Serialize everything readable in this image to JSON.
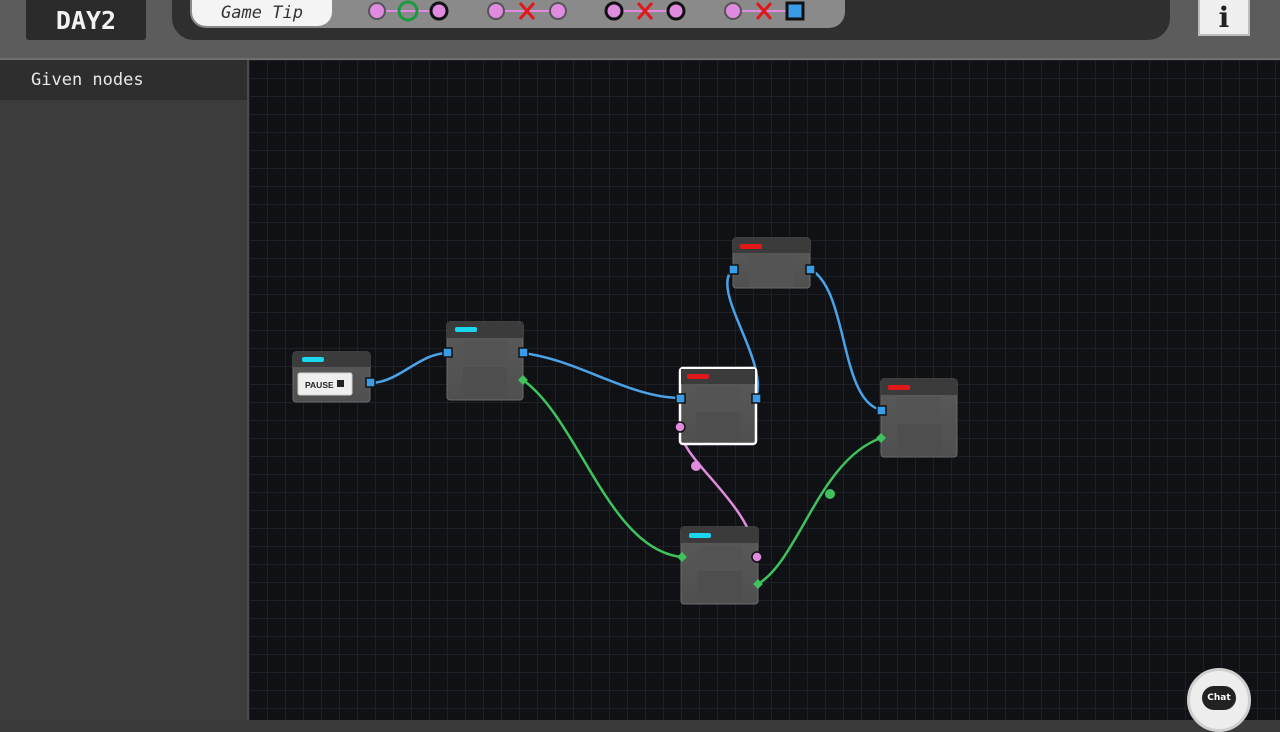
{
  "header": {
    "day_label": "DAY2",
    "tip_label": "Game Tip",
    "rules": [
      {
        "left": "port-pink",
        "link": "none",
        "right": "port-green",
        "right2": "port-black",
        "valid": true
      },
      {
        "left": "port-pink",
        "link": "x",
        "right": "port-pink",
        "valid": false
      },
      {
        "left": "port-black",
        "link": "x",
        "right": "port-pink",
        "valid": false
      },
      {
        "left": "port-pink",
        "link": "x",
        "right": "port-blue-square",
        "valid": false
      }
    ],
    "info_label": "i"
  },
  "sidebar": {
    "title": "Given nodes"
  },
  "graph": {
    "nodes": [
      {
        "id": "pause-node",
        "accent": "cyan",
        "button_label": "PAUSE"
      },
      {
        "id": "node-2",
        "accent": "cyan"
      },
      {
        "id": "node-3",
        "accent": "red",
        "selected": true
      },
      {
        "id": "node-4",
        "accent": "red"
      },
      {
        "id": "node-5",
        "accent": "red"
      },
      {
        "id": "node-6",
        "accent": "cyan"
      }
    ],
    "colors": {
      "accent_cyan": "#19d7ee",
      "accent_red": "#e01818",
      "wire_blue": "#4aa3e8",
      "wire_green": "#3fc25b",
      "wire_pink": "#e08ae0"
    }
  },
  "chat": {
    "label": "Chat"
  }
}
